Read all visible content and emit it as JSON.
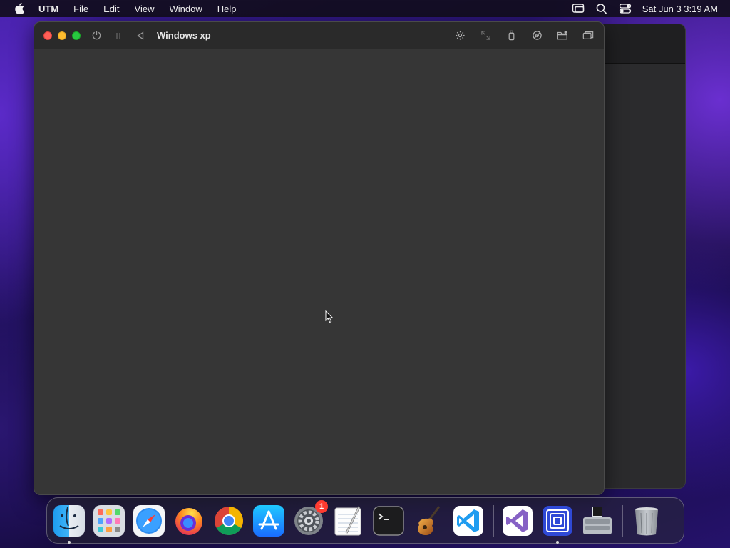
{
  "menubar": {
    "app_name": "UTM",
    "menus": [
      "File",
      "Edit",
      "View",
      "Window",
      "Help"
    ],
    "clock": "Sat Jun 3  3:19 AM",
    "status_icons": [
      "screen-mirroring-icon",
      "spotlight-search-icon",
      "control-center-icon"
    ]
  },
  "vm_window": {
    "title": "Windows xp",
    "toolbar_left": [
      "power-icon",
      "pause-icon",
      "restart-icon"
    ],
    "toolbar_right": [
      "display-brightness-icon",
      "resize-icon",
      "usb-drive-icon",
      "disk-icon",
      "shared-folder-icon",
      "windows-icon"
    ]
  },
  "dock": {
    "apps": [
      {
        "name": "Finder",
        "icon": "finder-icon",
        "running": true
      },
      {
        "name": "Launchpad",
        "icon": "launchpad-icon"
      },
      {
        "name": "Safari",
        "icon": "safari-icon"
      },
      {
        "name": "Firefox",
        "icon": "firefox-icon"
      },
      {
        "name": "Google Chrome",
        "icon": "chrome-icon"
      },
      {
        "name": "App Store",
        "icon": "app-store-icon"
      },
      {
        "name": "System Settings",
        "icon": "system-settings-icon",
        "badge": "1"
      },
      {
        "name": "TextEdit",
        "icon": "textedit-icon"
      },
      {
        "name": "Terminal",
        "icon": "terminal-icon"
      },
      {
        "name": "GarageBand",
        "icon": "garageband-icon"
      },
      {
        "name": "Visual Studio Code",
        "icon": "vscode-icon"
      }
    ],
    "recent_apps": [
      {
        "name": "Visual Studio",
        "icon": "visual-studio-icon"
      },
      {
        "name": "UTM",
        "icon": "utm-icon",
        "running": true
      },
      {
        "name": "Boot Camp Assistant",
        "icon": "bootcamp-icon"
      }
    ],
    "trash": {
      "name": "Trash",
      "icon": "trash-icon"
    }
  },
  "colors": {
    "close": "#ff5f57",
    "minimize": "#febc2e",
    "zoom": "#28c840",
    "window_bg": "#363636",
    "titlebar_bg": "#2a2a2a",
    "badge": "#ff3b30"
  }
}
